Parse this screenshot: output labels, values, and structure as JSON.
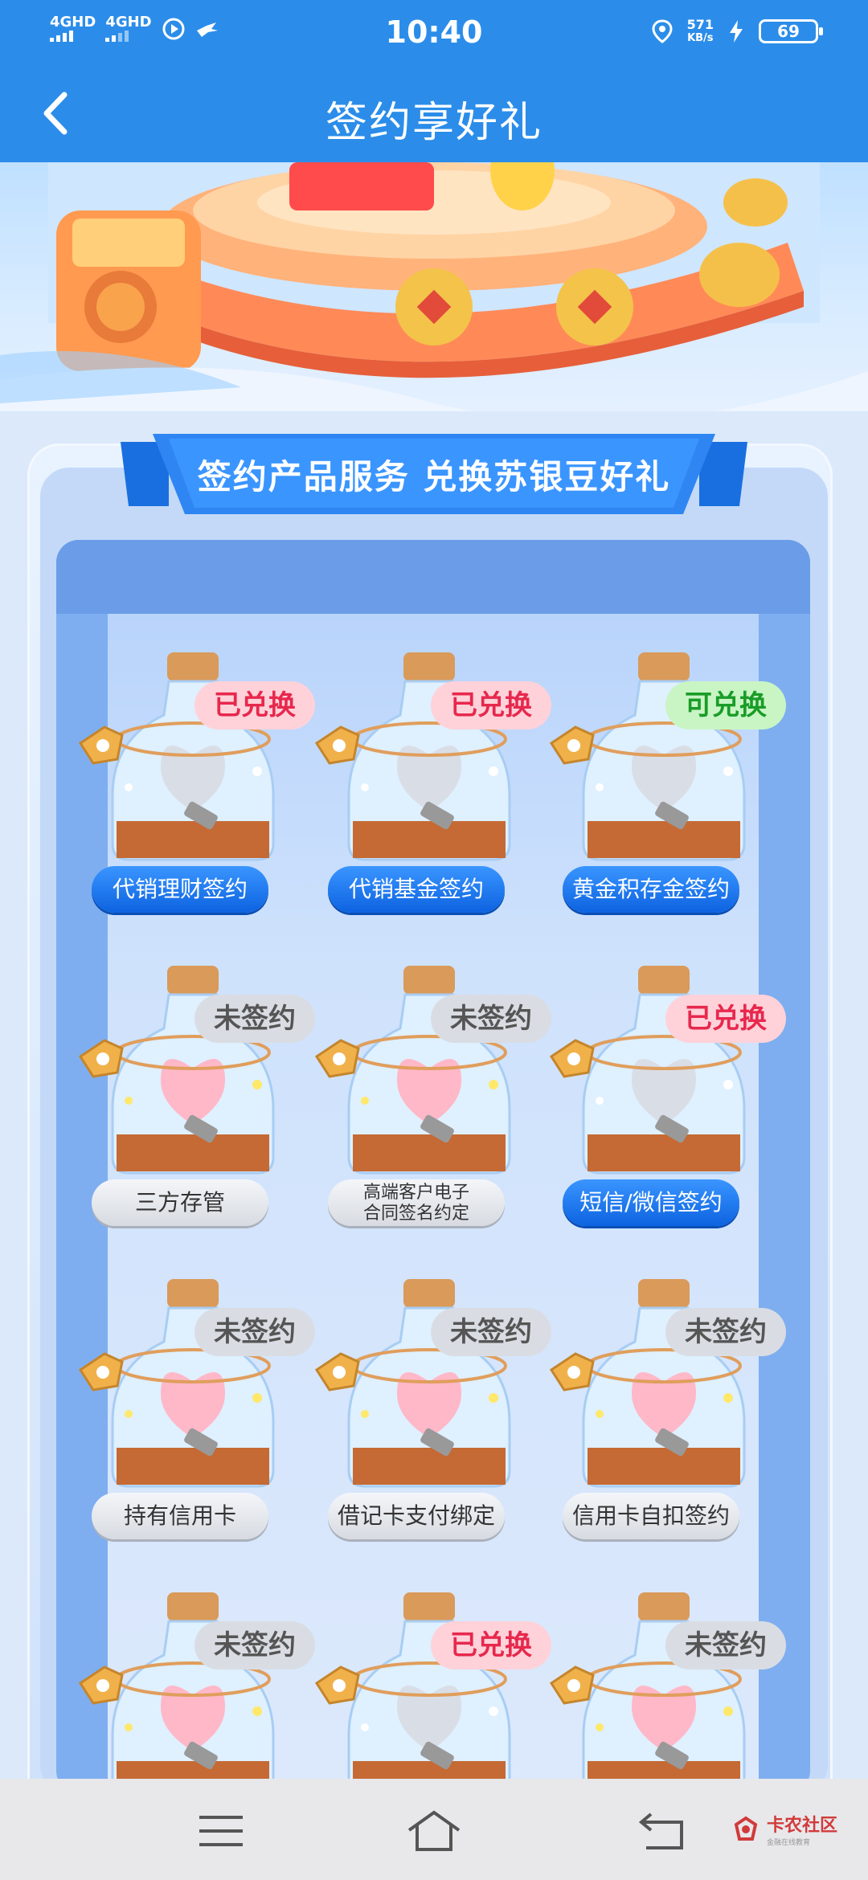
{
  "status_bar": {
    "network_1": "4GHD",
    "network_2": "4GHD",
    "time": "10:40",
    "speed_value": "571",
    "speed_unit": "KB/s",
    "battery": "69"
  },
  "header": {
    "title": "签约享好礼"
  },
  "section": {
    "title": "签约产品服务 兑换苏银豆好礼"
  },
  "items": [
    {
      "badge": "已兑换",
      "label": "代销理财签约"
    },
    {
      "badge": "已兑换",
      "label": "代销基金签约"
    },
    {
      "badge": "可兑换",
      "label": "黄金积存金签约"
    },
    {
      "badge": "未签约",
      "label": "三方存管"
    },
    {
      "badge": "未签约",
      "label_line1": "高端客户电子",
      "label_line2": "合同签名约定"
    },
    {
      "badge": "已兑换",
      "label": "短信/微信签约"
    },
    {
      "badge": "未签约",
      "label": "持有信用卡"
    },
    {
      "badge": "未签约",
      "label": "借记卡支付绑定"
    },
    {
      "badge": "未签约",
      "label": "信用卡自扣签约"
    },
    {
      "badge": "未签约"
    },
    {
      "badge": "已兑换"
    },
    {
      "badge": "未签约"
    }
  ],
  "watermark": {
    "text": "卡农社区",
    "sub": "金融在线教育"
  },
  "colors": {
    "brand_blue": "#2b8de9",
    "badge_done": "#e7284d",
    "badge_ok": "#1a9c28"
  }
}
